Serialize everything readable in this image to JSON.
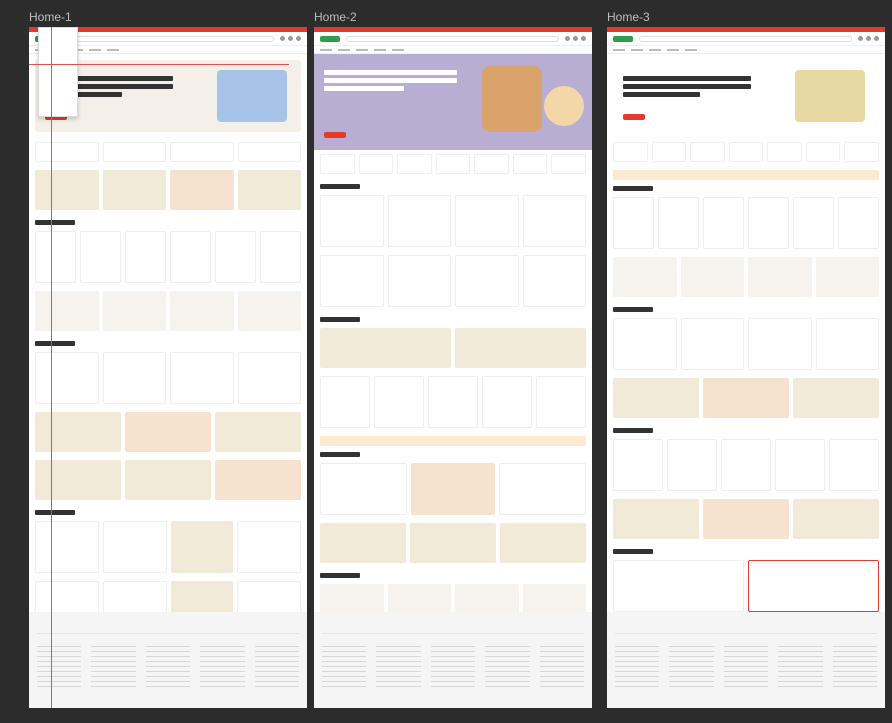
{
  "frames": [
    {
      "label": "Home-1"
    },
    {
      "label": "Home-2"
    },
    {
      "label": "Home-3"
    }
  ],
  "colors": {
    "canvas": "#2c2c2c",
    "accent": "#e23b2e",
    "brand": "#2f9d4c",
    "guide": "#e45050"
  }
}
